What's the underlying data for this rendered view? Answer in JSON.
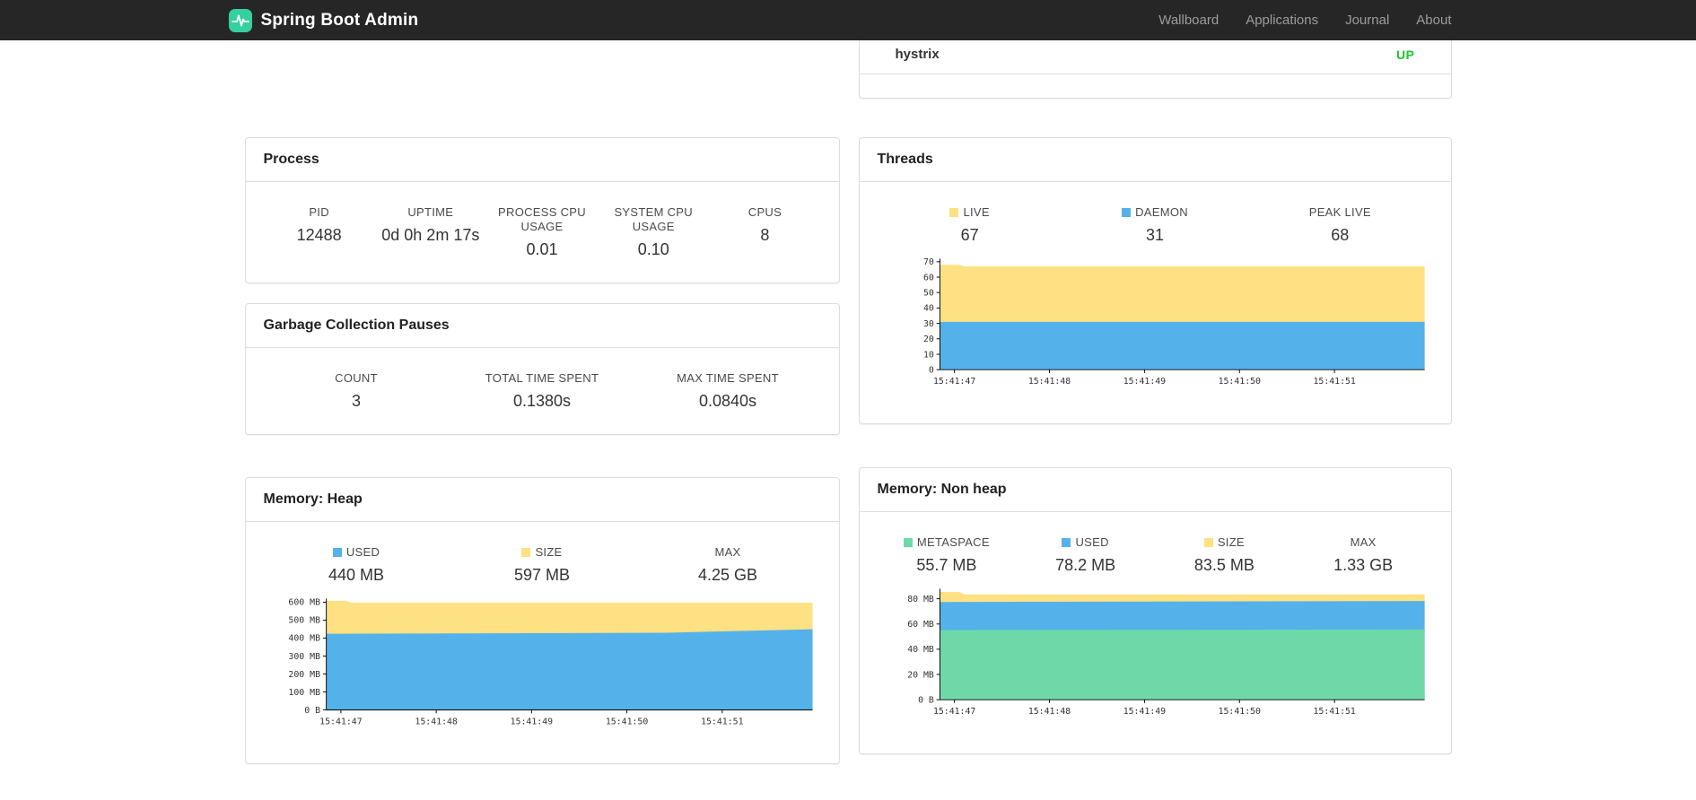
{
  "navbar": {
    "brand": "Spring Boot Admin",
    "links": [
      {
        "label": "Wallboard"
      },
      {
        "label": "Applications"
      },
      {
        "label": "Journal"
      },
      {
        "label": "About"
      }
    ]
  },
  "colors": {
    "brand_teal": "#35d0a0",
    "status_up": "#1fc42a",
    "chart_blue": "#55b1ea",
    "chart_yellow": "#fde183",
    "chart_green": "#6fd8a8"
  },
  "application_status": {
    "name": "hystrix",
    "status": "UP"
  },
  "process": {
    "title": "Process",
    "stats": [
      {
        "label": "PID",
        "value": "12488"
      },
      {
        "label": "UPTIME",
        "value": "0d 0h 2m 17s"
      },
      {
        "label": "PROCESS CPU USAGE",
        "value": "0.01"
      },
      {
        "label": "SYSTEM CPU USAGE",
        "value": "0.10"
      },
      {
        "label": "CPUS",
        "value": "8"
      }
    ]
  },
  "gc": {
    "title": "Garbage Collection Pauses",
    "stats": [
      {
        "label": "COUNT",
        "value": "3"
      },
      {
        "label": "TOTAL TIME SPENT",
        "value": "0.1380s"
      },
      {
        "label": "MAX TIME SPENT",
        "value": "0.0840s"
      }
    ]
  },
  "threads": {
    "title": "Threads",
    "legend": [
      {
        "label": "LIVE",
        "value": "67",
        "color": "#fde183"
      },
      {
        "label": "DAEMON",
        "value": "31",
        "color": "#55b1ea"
      },
      {
        "label": "PEAK LIVE",
        "value": "68"
      }
    ]
  },
  "memory_heap": {
    "title": "Memory: Heap",
    "legend": [
      {
        "label": "USED",
        "value": "440 MB",
        "color": "#55b1ea"
      },
      {
        "label": "SIZE",
        "value": "597 MB",
        "color": "#fde183"
      },
      {
        "label": "MAX",
        "value": "4.25 GB"
      }
    ]
  },
  "memory_nonheap": {
    "title": "Memory: Non heap",
    "legend": [
      {
        "label": "METASPACE",
        "value": "55.7 MB",
        "color": "#6fd8a8"
      },
      {
        "label": "USED",
        "value": "78.2 MB",
        "color": "#55b1ea"
      },
      {
        "label": "SIZE",
        "value": "83.5 MB",
        "color": "#fde183"
      },
      {
        "label": "MAX",
        "value": "1.33 GB"
      }
    ]
  },
  "chart_data": [
    {
      "id": "threads",
      "type": "area",
      "stacked": true,
      "title": "Threads",
      "y_max": 72,
      "y_ticks": [
        {
          "v": 0,
          "label": "0"
        },
        {
          "v": 10,
          "label": "10"
        },
        {
          "v": 20,
          "label": "20"
        },
        {
          "v": 30,
          "label": "30"
        },
        {
          "v": 40,
          "label": "40"
        },
        {
          "v": 50,
          "label": "50"
        },
        {
          "v": 60,
          "label": "60"
        },
        {
          "v": 70,
          "label": "70"
        }
      ],
      "x_labels": [
        "15:41:47",
        "15:41:48",
        "15:41:49",
        "15:41:50",
        "15:41:51"
      ],
      "points_are_stack_tops": true,
      "series": [
        {
          "name": "LIVE",
          "color": "#fde183",
          "points": [
            [
              0,
              68
            ],
            [
              0.04,
              68
            ],
            [
              0.05,
              67
            ],
            [
              1,
              67
            ]
          ]
        },
        {
          "name": "DAEMON",
          "color": "#55b1ea",
          "points": [
            [
              0,
              31
            ],
            [
              1,
              31
            ]
          ]
        }
      ]
    },
    {
      "id": "heap",
      "type": "area",
      "stacked": true,
      "title": "Memory: Heap (MB)",
      "y_max": 620,
      "y_ticks": [
        {
          "v": 0,
          "label": "0 B"
        },
        {
          "v": 100,
          "label": "100 MB"
        },
        {
          "v": 200,
          "label": "200 MB"
        },
        {
          "v": 300,
          "label": "300 MB"
        },
        {
          "v": 400,
          "label": "400 MB"
        },
        {
          "v": 500,
          "label": "500 MB"
        },
        {
          "v": 600,
          "label": "600 MB"
        }
      ],
      "x_labels": [
        "15:41:47",
        "15:41:48",
        "15:41:49",
        "15:41:50",
        "15:41:51"
      ],
      "points_are_stack_tops": true,
      "series": [
        {
          "name": "SIZE",
          "color": "#fde183",
          "points": [
            [
              0,
              608
            ],
            [
              0.04,
              608
            ],
            [
              0.05,
              597
            ],
            [
              1,
              597
            ]
          ]
        },
        {
          "name": "USED",
          "color": "#55b1ea",
          "points": [
            [
              0,
              424
            ],
            [
              0.7,
              430
            ],
            [
              1,
              449
            ]
          ]
        }
      ]
    },
    {
      "id": "nonheap",
      "type": "area",
      "stacked": true,
      "title": "Memory: Non heap (MB)",
      "y_max": 88,
      "y_ticks": [
        {
          "v": 0,
          "label": "0 B"
        },
        {
          "v": 20,
          "label": "20 MB"
        },
        {
          "v": 40,
          "label": "40 MB"
        },
        {
          "v": 60,
          "label": "60 MB"
        },
        {
          "v": 80,
          "label": "80 MB"
        }
      ],
      "x_labels": [
        "15:41:47",
        "15:41:48",
        "15:41:49",
        "15:41:50",
        "15:41:51"
      ],
      "points_are_stack_tops": true,
      "series": [
        {
          "name": "SIZE",
          "color": "#fde183",
          "points": [
            [
              0,
              85.5
            ],
            [
              0.04,
              85.5
            ],
            [
              0.05,
              83.5
            ],
            [
              1,
              83.5
            ]
          ]
        },
        {
          "name": "USED",
          "color": "#55b1ea",
          "points": [
            [
              0,
              77.5
            ],
            [
              1,
              78.2
            ]
          ]
        },
        {
          "name": "METASPACE",
          "color": "#6fd8a8",
          "points": [
            [
              0,
              55.2
            ],
            [
              1,
              55.7
            ]
          ]
        }
      ]
    }
  ]
}
